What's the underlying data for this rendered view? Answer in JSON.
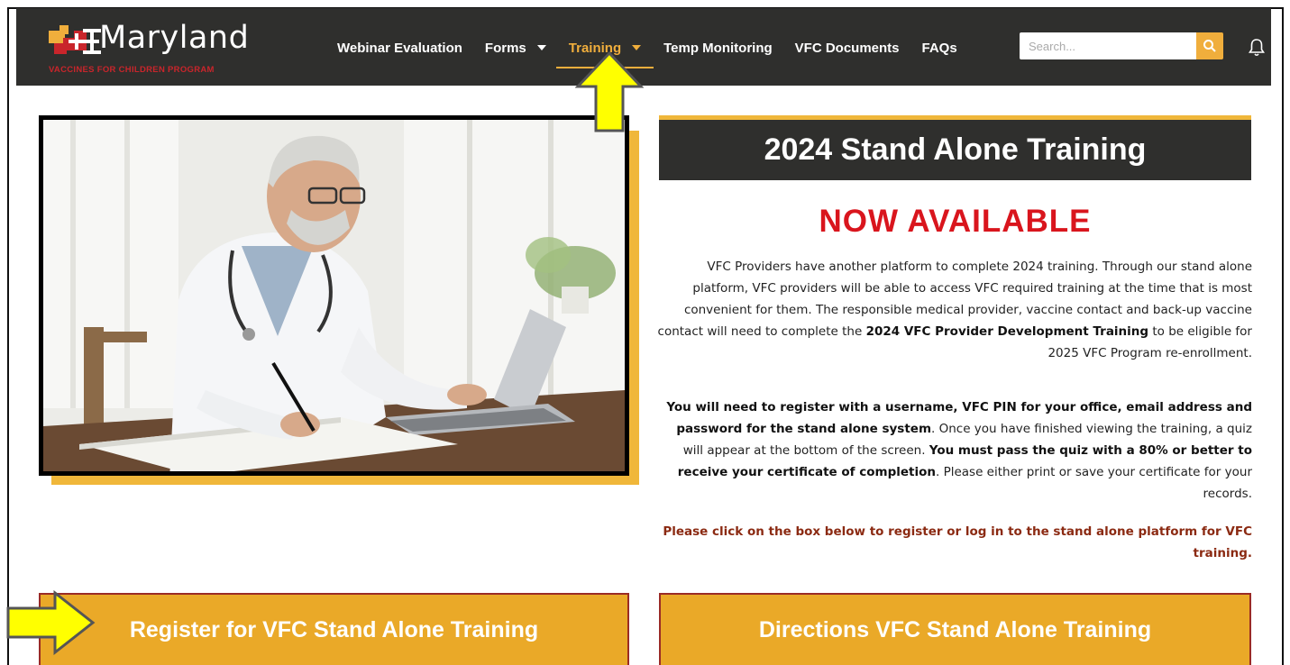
{
  "header": {
    "logo_text": "Maryland",
    "logo_subtext": "VACCINES FOR CHILDREN PROGRAM",
    "nav": [
      {
        "label": "Webinar Evaluation",
        "dropdown": false,
        "active": false
      },
      {
        "label": "Forms",
        "dropdown": true,
        "active": false
      },
      {
        "label": "Training",
        "dropdown": true,
        "active": true
      },
      {
        "label": "Temp Monitoring",
        "dropdown": false,
        "active": false
      },
      {
        "label": "VFC Documents",
        "dropdown": false,
        "active": false
      },
      {
        "label": "FAQs",
        "dropdown": false,
        "active": false
      }
    ],
    "search_placeholder": "Search..."
  },
  "main": {
    "title": "2024 Stand Alone Training",
    "subtitle": "NOW AVAILABLE",
    "p1_a": "VFC Providers have another platform to complete 2024 training. Through our stand alone platform, VFC providers will be able to access VFC required training at the time that is most convenient for them. The responsible medical provider, vaccine contact and back-up vaccine contact will need to complete the ",
    "p1_bold": "2024 VFC Provider Development Training",
    "p1_b": " to be eligible for 2025 VFC Program re-enrollment.",
    "p2_bold1": "You will need to register with a username, VFC PIN for your office, email address and password for the stand alone system",
    "p2_a": ". Once you have finished viewing the training, a quiz will appear at the bottom of the screen. ",
    "p2_bold2": "You must pass the quiz with a 80% or better to receive your certificate of completion",
    "p2_b": ". Please either print or save your certificate for your records.",
    "p3": "Please click on the box below to register or log in to the stand alone platform for VFC training.",
    "register_button": "Register for VFC Stand Alone Training",
    "directions_button": "Directions VFC Stand Alone Training"
  },
  "colors": {
    "header_bg": "#2f2f2d",
    "accent_gold": "#f0ae3c",
    "alert_red": "#d9151d",
    "cta_border": "#9a2b25",
    "annotation_arrow": "#ffff00"
  },
  "icons": {
    "search": "search-icon",
    "bell": "bell-icon",
    "caret": "caret-down-icon"
  }
}
